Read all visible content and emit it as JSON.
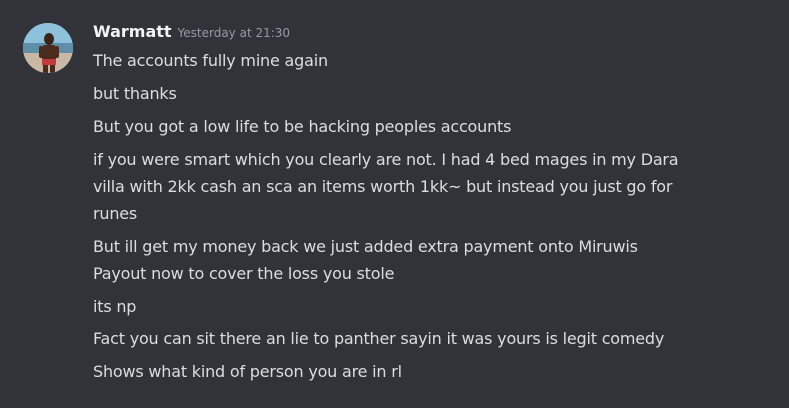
{
  "message": {
    "author": "Warmatt",
    "timestamp": "Yesterday at 21:30",
    "lines": [
      "The accounts fully mine again",
      "but thanks",
      "But you got a low life to be hacking peoples accounts",
      "if you were smart which you clearly are not. I had 4 bed mages in my Dara",
      "villa with 2kk cash an sca an items worth 1kk~ but instead you just go for",
      "runes",
      "But ill get my money back we just added extra payment onto Miruwis",
      "Payout now to cover the loss you stole",
      "its np",
      "Fact you can sit there an lie to panther sayin it was yours is legit comedy",
      "Shows what kind of person you are in rl"
    ]
  }
}
